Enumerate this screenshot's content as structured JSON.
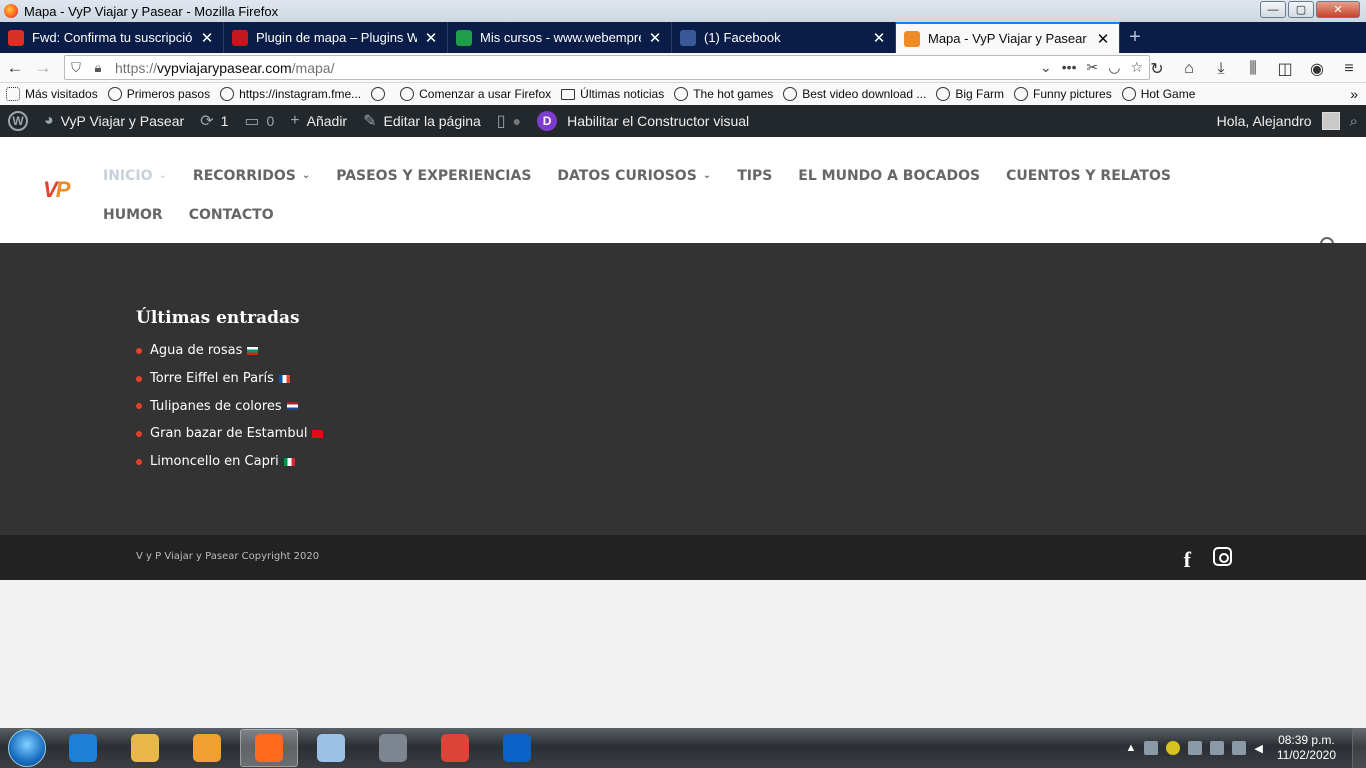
{
  "window": {
    "title": "Mapa - VyP Viajar y Pasear - Mozilla Firefox",
    "controls": {
      "minimize": "—",
      "maximize": "▢",
      "close": "✕"
    }
  },
  "tabs": [
    {
      "label": "Fwd: Confirma tu suscripción a",
      "favicon": "gmail-icon",
      "color": "#d93025"
    },
    {
      "label": "Plugin de mapa – Plugins Word",
      "favicon": "wordpress-plugin-icon",
      "color": "#c4161c"
    },
    {
      "label": "Mis cursos - www.webempresa.",
      "favicon": "webempresa-icon",
      "color": "#1e9e4a"
    },
    {
      "label": "(1) Facebook",
      "favicon": "facebook-icon",
      "color": "#3b5998"
    },
    {
      "label": "Mapa - VyP Viajar y Pasear",
      "favicon": "vyp-icon",
      "color": "#f08a24",
      "active": true
    }
  ],
  "newtab": "+",
  "urlbar": {
    "scheme": "https://",
    "host": "vypviajarypasear.com",
    "path": "/mapa/"
  },
  "bookmarks": [
    {
      "label": "Más visitados",
      "icon": "gear"
    },
    {
      "label": "Primeros pasos",
      "icon": "globe"
    },
    {
      "label": "https://instagram.fme...",
      "icon": "globe"
    },
    {
      "label": "",
      "icon": "globe"
    },
    {
      "label": "Comenzar a usar Firefox",
      "icon": "globe"
    },
    {
      "label": "Últimas noticias",
      "icon": "folder"
    },
    {
      "label": "The hot games",
      "icon": "globe"
    },
    {
      "label": "Best video download ...",
      "icon": "globe"
    },
    {
      "label": "Big Farm",
      "icon": "globe"
    },
    {
      "label": "Funny pictures",
      "icon": "globe"
    },
    {
      "label": "Hot Game",
      "icon": "globe"
    }
  ],
  "wpbar": {
    "site_name": "VyP Viajar y Pasear",
    "updates_count": "1",
    "comments_count": "0",
    "add_new": "Añadir",
    "edit_page": "Editar la página",
    "divi_letter": "D",
    "visual_builder": "Habilitar el Constructor visual",
    "greeting": "Hola, Alejandro"
  },
  "site": {
    "logo_v": "V",
    "logo_p": "P",
    "nav": [
      {
        "label": "INICIO",
        "dropdown": true,
        "current": true
      },
      {
        "label": "RECORRIDOS",
        "dropdown": true
      },
      {
        "label": "PASEOS Y EXPERIENCIAS",
        "dropdown": false
      },
      {
        "label": "DATOS CURIOSOS",
        "dropdown": true
      },
      {
        "label": "TIPS",
        "dropdown": false
      },
      {
        "label": "EL MUNDO A BOCADOS",
        "dropdown": false
      },
      {
        "label": "CUENTOS Y RELATOS",
        "dropdown": false
      },
      {
        "label": "HUMOR",
        "dropdown": false
      },
      {
        "label": "CONTACTO",
        "dropdown": false
      }
    ]
  },
  "footer": {
    "widget_title": "Últimas entradas",
    "recent_posts": [
      {
        "label": "Agua de rosas",
        "flag": [
          "#ffffff",
          "#00966e",
          "#d62612"
        ]
      },
      {
        "label": "Torre Eiffel en París",
        "flag": [
          "#0055a4",
          "#ffffff",
          "#ef4135"
        ],
        "vertical": true
      },
      {
        "label": "Tulipanes de colores",
        "flag": [
          "#ae1c28",
          "#ffffff",
          "#21468b"
        ]
      },
      {
        "label": "Gran bazar de Estambul",
        "flag": [
          "#e30a17",
          "#e30a17",
          "#e30a17"
        ]
      },
      {
        "label": "Limoncello en Capri",
        "flag": [
          "#009246",
          "#ffffff",
          "#ce2b37"
        ],
        "vertical": true
      }
    ],
    "copyright": "V y P Viajar y Pasear Copyright 2020",
    "social": {
      "facebook": "f"
    }
  },
  "taskbar": {
    "apps": [
      {
        "name": "internet-explorer-icon",
        "color": "#1e7fd6"
      },
      {
        "name": "file-explorer-icon",
        "color": "#e8b84a"
      },
      {
        "name": "media-player-icon",
        "color": "#f0a030"
      },
      {
        "name": "firefox-icon",
        "color": "#ff6a1f",
        "active": true
      },
      {
        "name": "paint-icon",
        "color": "#9bc2e6"
      },
      {
        "name": "app-icon",
        "color": "#7d8590"
      },
      {
        "name": "chrome-icon",
        "color": "#db4437"
      },
      {
        "name": "outlook-icon",
        "color": "#0a64c8"
      }
    ],
    "time": "08:39 p.m.",
    "date": "11/02/2020"
  }
}
